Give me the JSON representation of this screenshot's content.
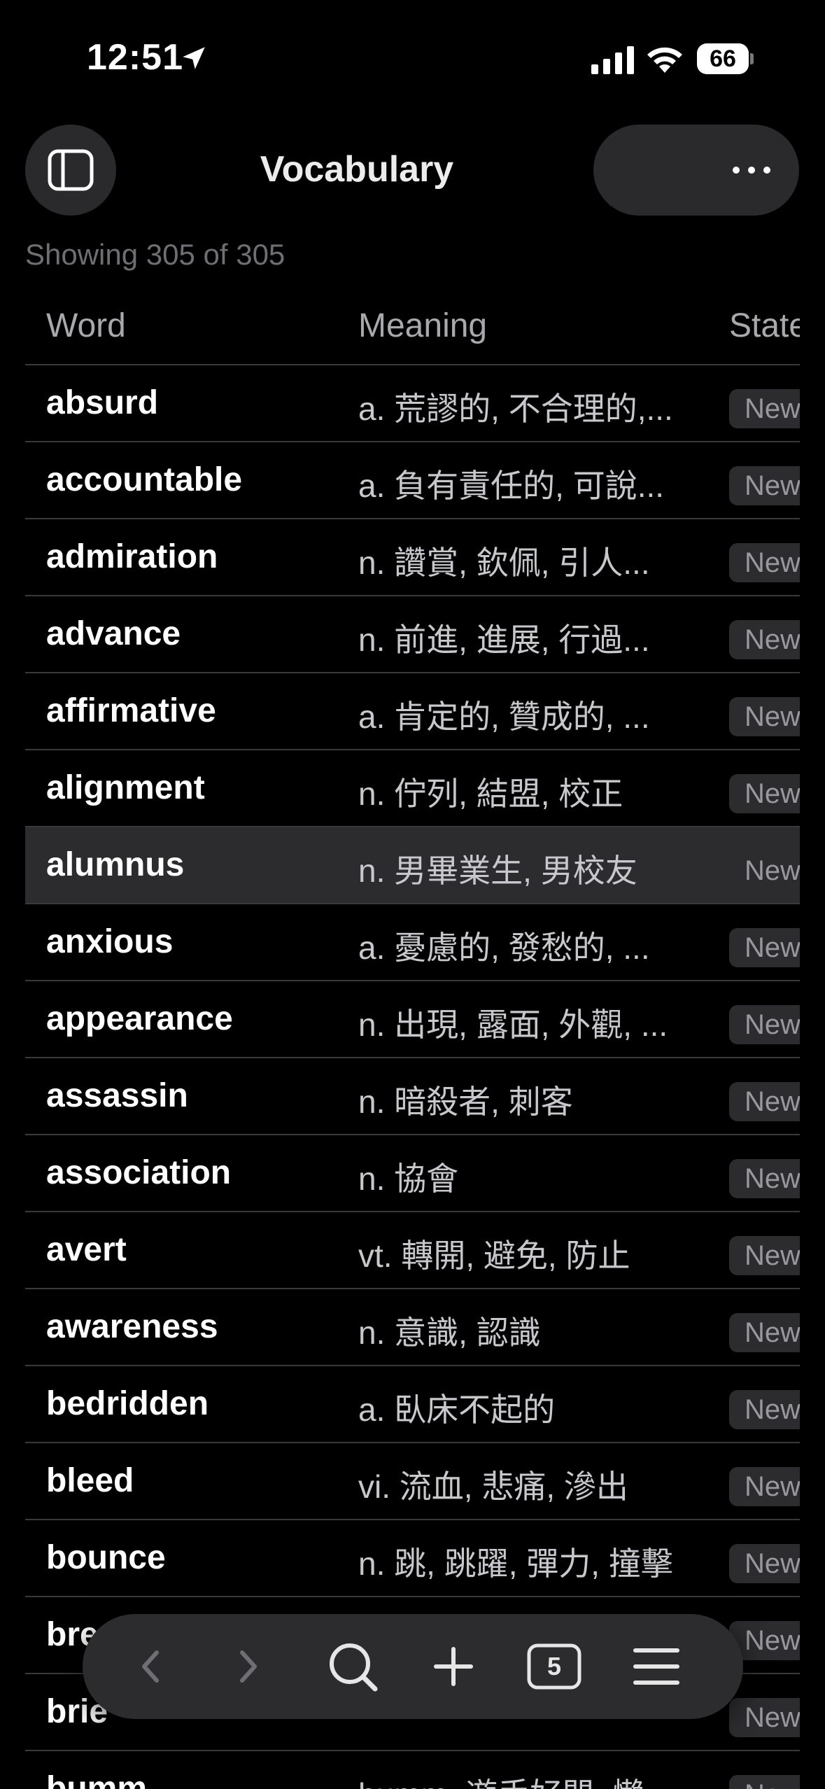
{
  "status_bar": {
    "time": "12:51",
    "battery": "66"
  },
  "nav": {
    "title": "Vocabulary"
  },
  "summary": "Showing 305 of 305",
  "table": {
    "headers": {
      "word": "Word",
      "meaning": "Meaning",
      "state": "State"
    },
    "rows": [
      {
        "word": "absurd",
        "meaning": "a. 荒謬的, 不合理的,...",
        "state": "New"
      },
      {
        "word": "accountable",
        "meaning": "a. 負有責任的, 可說...",
        "state": "New"
      },
      {
        "word": "admiration",
        "meaning": "n. 讚賞, 欽佩, 引人...",
        "state": "New"
      },
      {
        "word": "advance",
        "meaning": "n. 前進, 進展, 行過...",
        "state": "New"
      },
      {
        "word": "affirmative",
        "meaning": "a. 肯定的, 贊成的, ...",
        "state": "New"
      },
      {
        "word": "alignment",
        "meaning": "n. 佇列, 結盟, 校正",
        "state": "New"
      },
      {
        "word": "alumnus",
        "meaning": "n. 男畢業生, 男校友",
        "state": "New",
        "selected": true
      },
      {
        "word": "anxious",
        "meaning": "a. 憂慮的, 發愁的, ...",
        "state": "New"
      },
      {
        "word": "appearance",
        "meaning": "n. 出現, 露面, 外觀, ...",
        "state": "New"
      },
      {
        "word": "assassin",
        "meaning": "n. 暗殺者, 刺客",
        "state": "New"
      },
      {
        "word": "association",
        "meaning": "n. 協會",
        "state": "New"
      },
      {
        "word": "avert",
        "meaning": "vt. 轉開, 避免, 防止",
        "state": "New"
      },
      {
        "word": "awareness",
        "meaning": "n. 意識, 認識",
        "state": "New"
      },
      {
        "word": "bedridden",
        "meaning": "a. 臥床不起的",
        "state": "New"
      },
      {
        "word": "bleed",
        "meaning": "vi. 流血, 悲痛, 滲出",
        "state": "New"
      },
      {
        "word": "bounce",
        "meaning": "n. 跳, 跳躍, 彈力, 撞擊",
        "state": "New"
      },
      {
        "word": "bre",
        "meaning": "",
        "state": "New"
      },
      {
        "word": "brie",
        "meaning": "",
        "state": "New"
      },
      {
        "word": "bumm",
        "meaning": "bumm. 遊手好閒, 懶",
        "state": "New"
      }
    ]
  },
  "toolbar": {
    "tabs_count": "5"
  },
  "icons": {
    "location": "location-arrow-icon",
    "signal": "cellular-signal-icon",
    "wifi": "wifi-icon",
    "sidebar": "sidebar-icon",
    "more": "ellipsis-icon",
    "back": "chevron-left-icon",
    "forward": "chevron-right-icon",
    "search": "search-icon",
    "add": "plus-icon",
    "tabs": "tabs-icon",
    "menu": "hamburger-menu-icon"
  }
}
